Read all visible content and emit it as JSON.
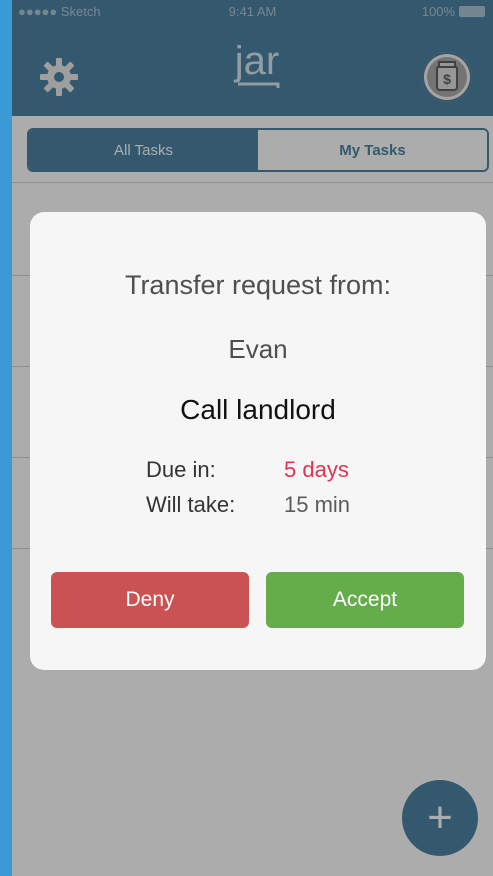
{
  "status_bar": {
    "carrier": "●●●●● Sketch",
    "time": "9:41 AM",
    "battery": "100%"
  },
  "header": {
    "app_logo_text": "jar",
    "settings_icon": "gear-icon",
    "jar_button_icon": "money-jar-icon"
  },
  "tabs": [
    {
      "label": "All Tasks",
      "selected": true
    },
    {
      "label": "My Tasks",
      "selected": false
    }
  ],
  "fab": {
    "label": "+"
  },
  "dialog": {
    "title": "Transfer request from:",
    "requester": "Evan",
    "task": "Call landlord",
    "due_label": "Due in:",
    "due_value": "5 days",
    "take_label": "Will take:",
    "take_value": "15 min",
    "deny_label": "Deny",
    "accept_label": "Accept"
  },
  "colors": {
    "primary": "#25698f",
    "due_highlight": "#e2344f",
    "deny": "#cb5252",
    "accept": "#65ad4a"
  }
}
